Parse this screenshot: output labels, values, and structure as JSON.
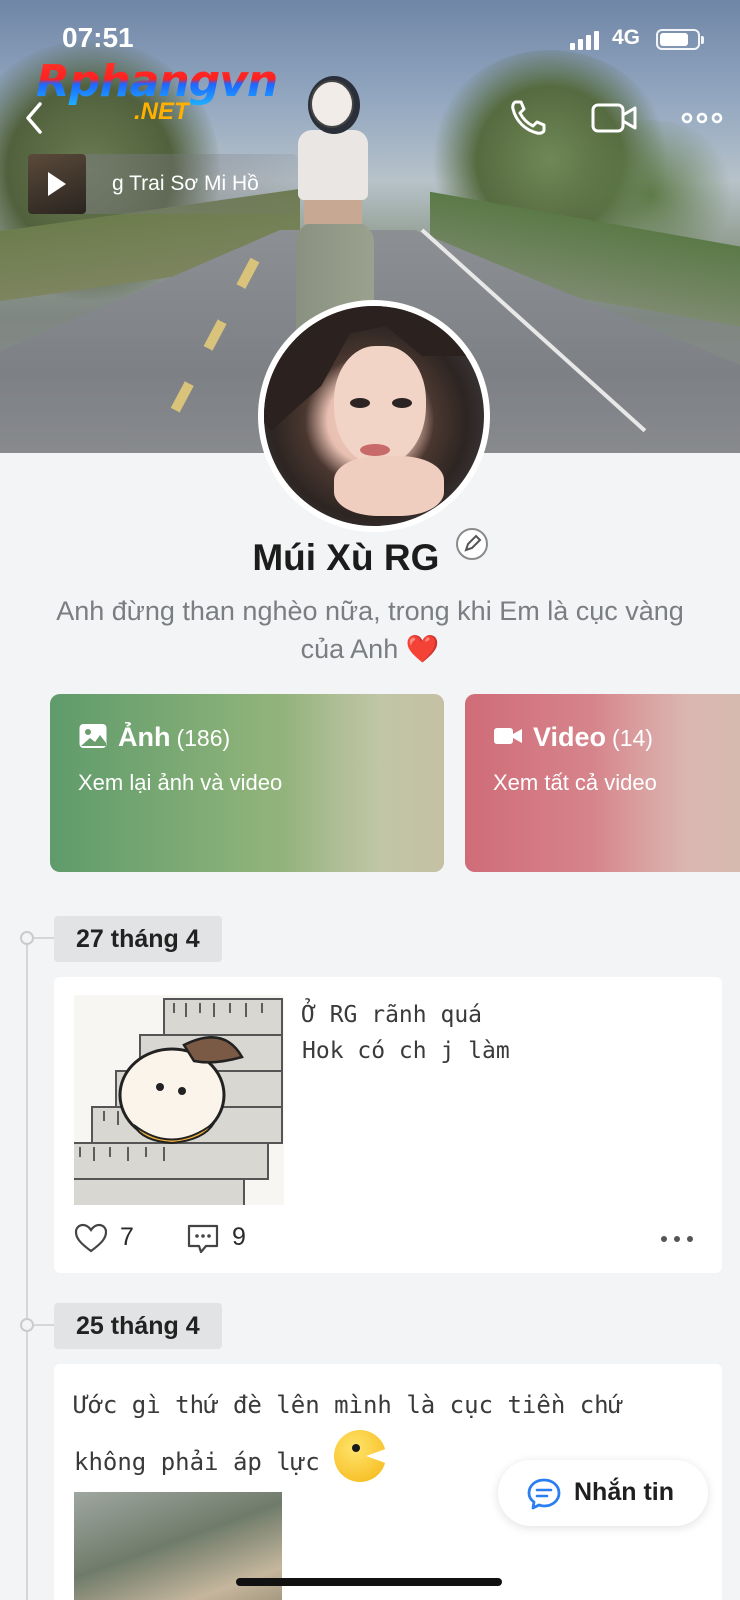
{
  "status_bar": {
    "time": "07:51",
    "network": "4G"
  },
  "watermark": {
    "main": "Rphangvn",
    "sub": ".NET"
  },
  "now_playing": {
    "title": "g Trai Sơ Mi Hồ"
  },
  "profile": {
    "name": "Múi Xù RG",
    "bio": "Anh đừng than nghèo nữa, trong khi Em là cục vàng của Anh",
    "bio_emoji": "❤️"
  },
  "media": {
    "photos": {
      "label": "Ảnh",
      "count": "(186)",
      "subtitle": "Xem lại ảnh và video"
    },
    "videos": {
      "label": "Video",
      "count": "(14)",
      "subtitle": "Xem tất cả video"
    }
  },
  "posts": [
    {
      "date": "27 tháng 4",
      "text": "Ở RG rãnh quá\nHok có ch j làm",
      "likes": "7",
      "comments": "9"
    },
    {
      "date": "25 tháng 4",
      "text": "Ước gì thứ đè lên mình là cục tiền chứ\nkhông phải áp lực"
    }
  ],
  "message_button": {
    "label": "Nhắn tin"
  },
  "colors": {
    "photos_card": "#5f9b6b",
    "videos_card": "#cf6c78",
    "message_icon": "#2a7ef2",
    "heart": "#e0262e"
  }
}
